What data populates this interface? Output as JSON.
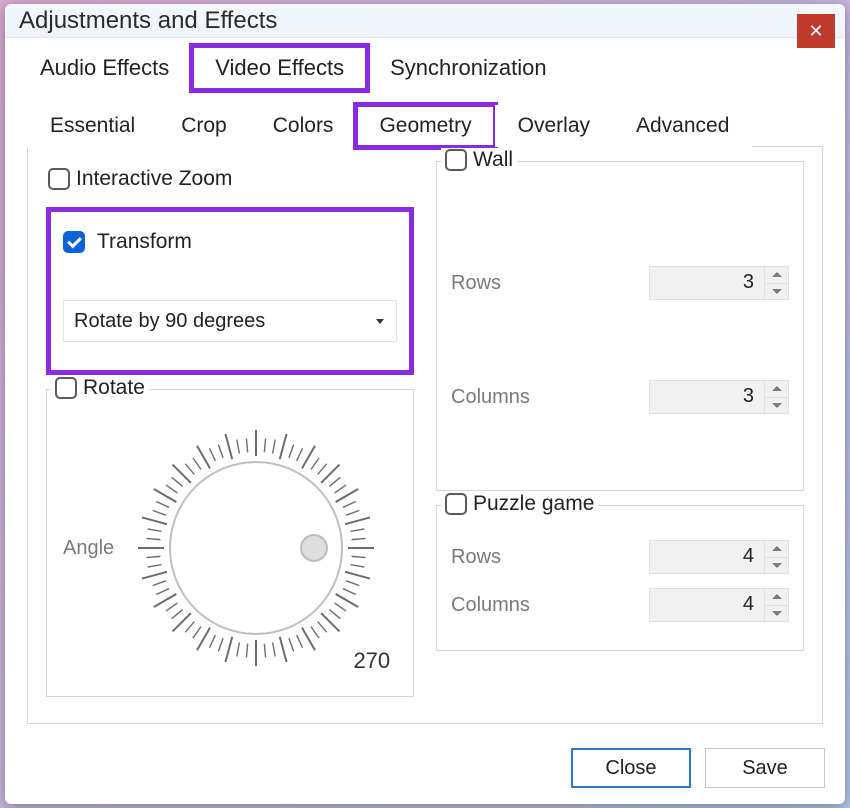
{
  "window": {
    "title": "Adjustments and Effects"
  },
  "primary_tabs": {
    "audio": "Audio Effects",
    "video": "Video Effects",
    "sync": "Synchronization",
    "active": "video"
  },
  "sub_tabs": {
    "essential": "Essential",
    "crop": "Crop",
    "colors": "Colors",
    "geometry": "Geometry",
    "overlay": "Overlay",
    "advanced": "Advanced",
    "active": "geometry"
  },
  "geometry": {
    "interactive_zoom": {
      "label": "Interactive Zoom",
      "checked": false
    },
    "transform": {
      "label": "Transform",
      "checked": true,
      "dropdown_value": "Rotate by 90 degrees"
    },
    "rotate": {
      "label": "Rotate",
      "checked": false,
      "angle_label": "Angle",
      "angle_value": "270"
    },
    "wall": {
      "label": "Wall",
      "checked": false,
      "rows_label": "Rows",
      "rows_value": "3",
      "cols_label": "Columns",
      "cols_value": "3"
    },
    "puzzle": {
      "label": "Puzzle game",
      "checked": false,
      "rows_label": "Rows",
      "rows_value": "4",
      "cols_label": "Columns",
      "cols_value": "4"
    }
  },
  "footer": {
    "close": "Close",
    "save": "Save"
  },
  "highlight_color": "#8a2be2"
}
